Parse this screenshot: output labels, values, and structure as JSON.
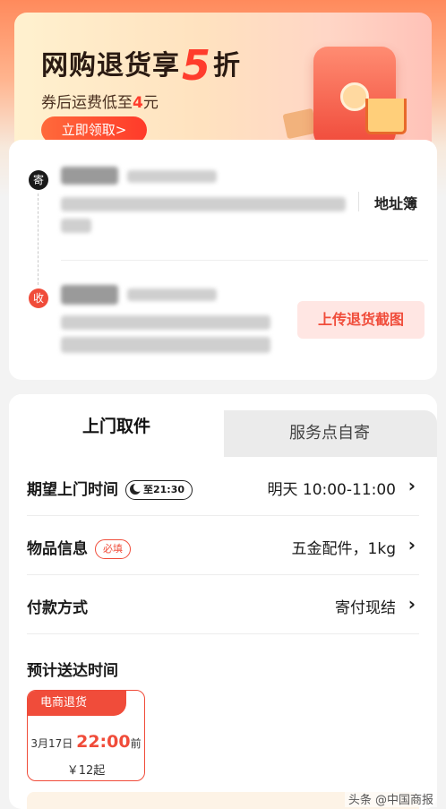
{
  "banner": {
    "title_before": "网购退货享",
    "title_number": "5",
    "title_after": "折",
    "sub_before": "券后运费低至",
    "sub_amount": "4",
    "sub_after": "元",
    "cta": "立即领取>"
  },
  "address": {
    "send_badge": "寄",
    "recv_badge": "收",
    "address_book": "地址簿",
    "upload_button": "上传退货截图"
  },
  "tabs": {
    "active": "上门取件",
    "inactive": "服务点自寄"
  },
  "rows": {
    "pickup_time_label": "期望上门时间",
    "pickup_time_pill": "至21:30",
    "pickup_time_value": "明天 10:00-11:00",
    "item_label": "物品信息",
    "item_required": "必填",
    "item_value": "五金配件，1kg",
    "payment_label": "付款方式",
    "payment_value": "寄付现结"
  },
  "eta": {
    "title": "预计送达时间",
    "card_head": "电商退货",
    "date": "3月17日",
    "time": "22:00",
    "suffix": "前",
    "price": "￥12起"
  },
  "watermark": "头条 @中国商报",
  "colors": {
    "accent": "#f04c3a",
    "banner_cta": "#ff3a2a"
  }
}
